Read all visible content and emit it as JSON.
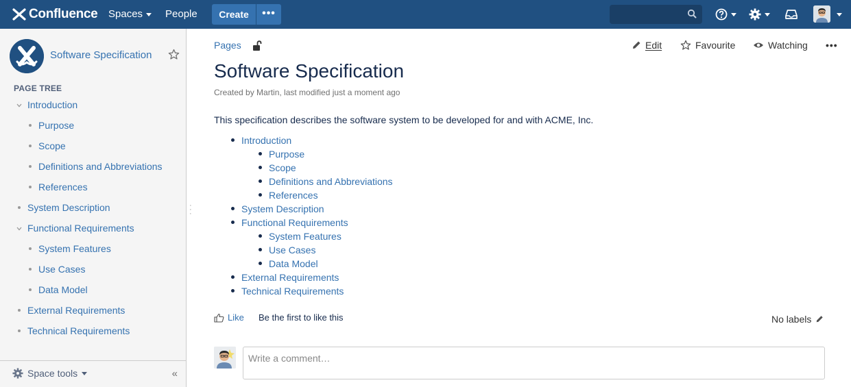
{
  "topbar": {
    "logo_text": "Confluence",
    "spaces_label": "Spaces",
    "people_label": "People",
    "create_label": "Create",
    "more_label": "•••",
    "search_placeholder": "",
    "icons": [
      "help-icon",
      "gear-icon",
      "notifications-icon",
      "user-avatar"
    ]
  },
  "sidebar": {
    "space_title": "Software Specification",
    "tree_heading": "PAGE TREE",
    "tree": [
      {
        "label": "Introduction",
        "level": 0,
        "expanded": true
      },
      {
        "label": "Purpose",
        "level": 1
      },
      {
        "label": "Scope",
        "level": 1
      },
      {
        "label": "Definitions and Abbreviations",
        "level": 1
      },
      {
        "label": "References",
        "level": 1
      },
      {
        "label": "System Description",
        "level": 0
      },
      {
        "label": "Functional Requirements",
        "level": 0,
        "expanded": true
      },
      {
        "label": "System Features",
        "level": 1
      },
      {
        "label": "Use Cases",
        "level": 1
      },
      {
        "label": "Data Model",
        "level": 1
      },
      {
        "label": "External Requirements",
        "level": 0
      },
      {
        "label": "Technical Requirements",
        "level": 0
      }
    ],
    "space_tools_label": "Space tools",
    "collapse_label": "«"
  },
  "page": {
    "breadcrumb": "Pages",
    "actions": {
      "edit": "Edit",
      "favourite": "Favourite",
      "watching": "Watching",
      "more": "•••"
    },
    "title": "Software Specification",
    "byline": "Created by Martin, last modified just a moment ago",
    "intro": "This specification describes the software system to be developed for and with ACME, Inc.",
    "toc": [
      {
        "label": "Introduction",
        "level": 0
      },
      {
        "label": "Purpose",
        "level": 1
      },
      {
        "label": "Scope",
        "level": 1
      },
      {
        "label": "Definitions and Abbreviations",
        "level": 1
      },
      {
        "label": "References",
        "level": 1
      },
      {
        "label": "System Description",
        "level": 0
      },
      {
        "label": "Functional Requirements",
        "level": 0
      },
      {
        "label": "System Features",
        "level": 1
      },
      {
        "label": "Use Cases",
        "level": 1
      },
      {
        "label": "Data Model",
        "level": 1
      },
      {
        "label": "External Requirements",
        "level": 0
      },
      {
        "label": "Technical Requirements",
        "level": 0
      }
    ],
    "like_label": "Like",
    "like_note": "Be the first to like this",
    "labels_text": "No labels",
    "comment_placeholder": "Write a comment…"
  },
  "colors": {
    "topbar": "#205081",
    "link": "#3572b0",
    "create": "#3572b0"
  }
}
